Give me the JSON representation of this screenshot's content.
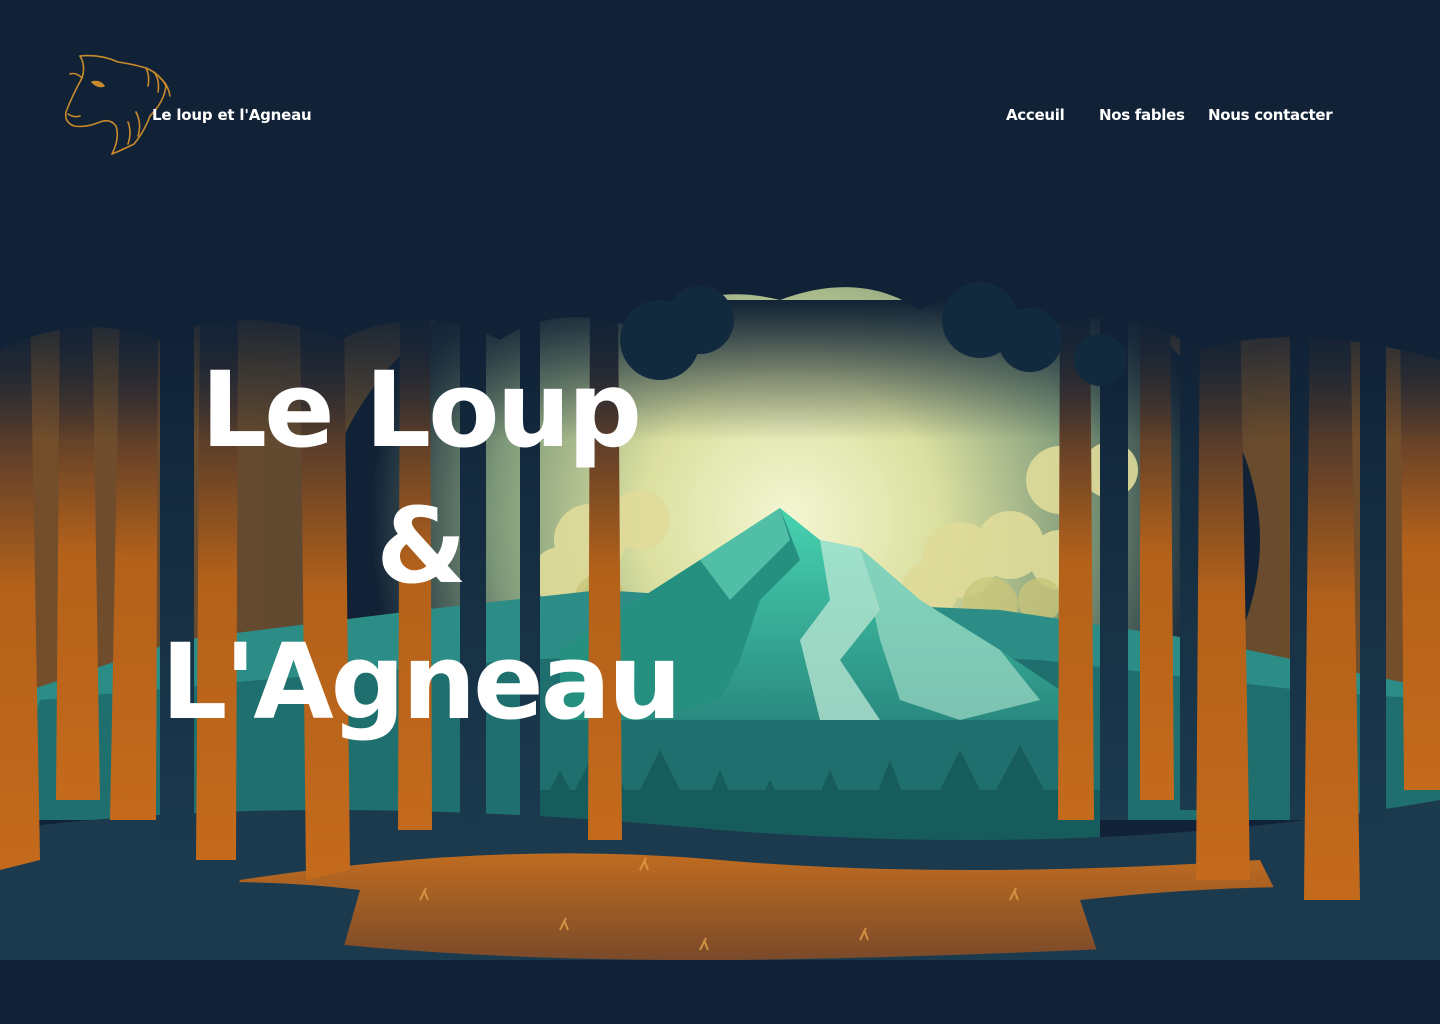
{
  "brand": {
    "name": "Le loup et l'Agneau",
    "logo_icon": "lamb-head-icon",
    "logo_color": "#c98a2c"
  },
  "nav": {
    "items": [
      {
        "label": "Acceuil"
      },
      {
        "label": "Nos fables"
      },
      {
        "label": "Nous contacter"
      }
    ]
  },
  "hero": {
    "title_line_1": "Le Loup",
    "title_line_2": "&",
    "title_line_3": "L'Agneau",
    "illustration_icon": "forest-mountain-illustration"
  },
  "colors": {
    "background": "#112236",
    "text": "#ffffff",
    "tree_orange": "#b3611a",
    "mountain_teal": "#2f9a8c",
    "sky_glow": "#e8ecb8"
  }
}
